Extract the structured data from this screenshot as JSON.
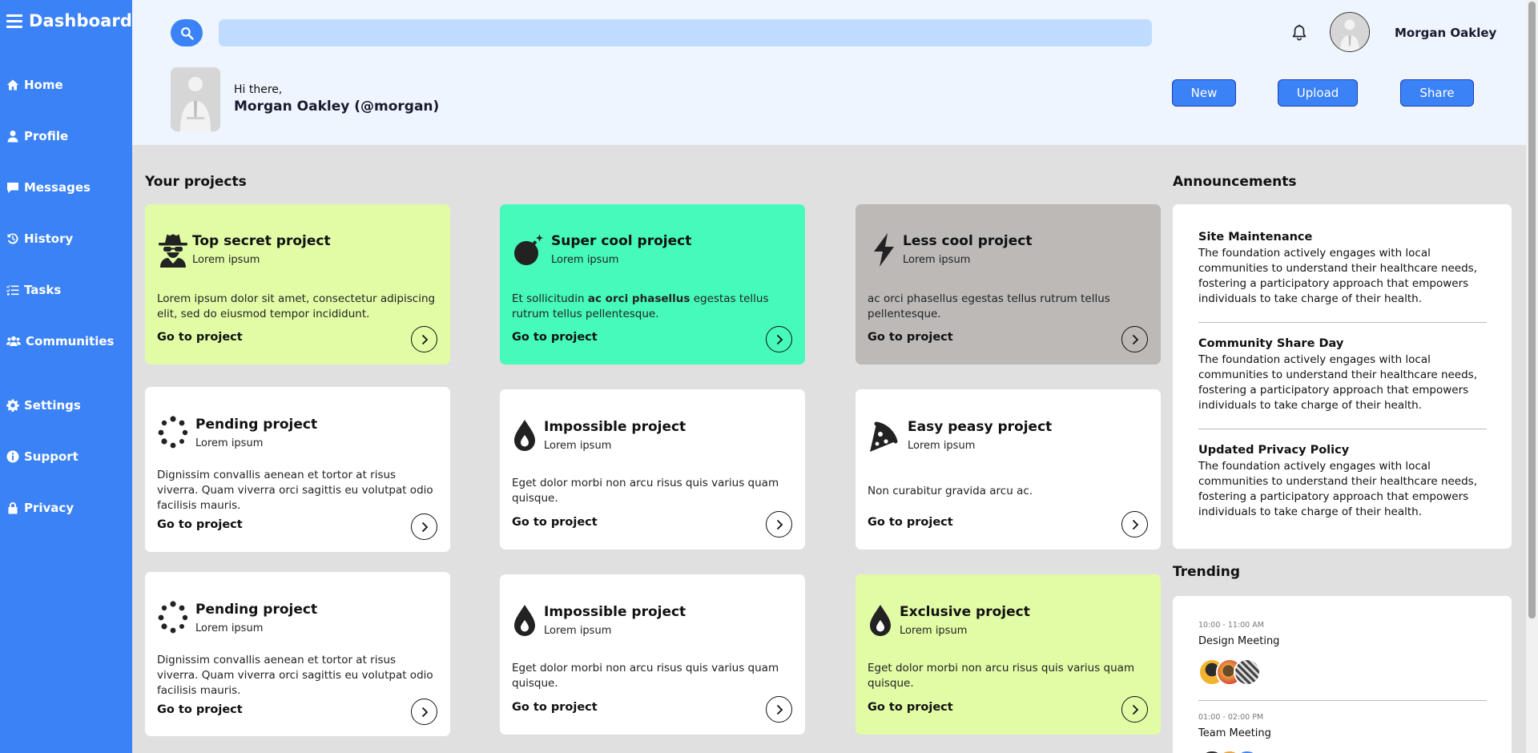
{
  "sidebar": {
    "title": "Dashboard",
    "items": [
      {
        "label": "Home",
        "icon": "home-icon"
      },
      {
        "label": "Profile",
        "icon": "user-icon"
      },
      {
        "label": "Messages",
        "icon": "message-icon"
      },
      {
        "label": "History",
        "icon": "history-icon"
      },
      {
        "label": "Tasks",
        "icon": "tasks-icon"
      },
      {
        "label": "Communities",
        "icon": "users-icon"
      },
      {
        "label": "Settings",
        "icon": "gear-icon"
      },
      {
        "label": "Support",
        "icon": "info-icon"
      },
      {
        "label": "Privacy",
        "icon": "lock-icon"
      }
    ]
  },
  "header": {
    "search": {
      "value": "",
      "placeholder": ""
    },
    "user_name": "Morgan Oakley",
    "greeting": "Hi there,",
    "greeting_name": "Morgan Oakley (@morgan)",
    "buttons": {
      "new": "New",
      "upload": "Upload",
      "share": "Share"
    }
  },
  "projects": {
    "title": "Your projects",
    "cards": [
      {
        "name": "Top secret project",
        "sub": "Lorem ipsum",
        "desc": "Lorem ipsum dolor sit amet, consectetur adipiscing elit, sed do eiusmod tempor incididunt.",
        "link": "Go to project",
        "icon": "spy-icon",
        "bg": "#e2fca6"
      },
      {
        "name": "Super cool project",
        "sub": "Lorem ipsum",
        "desc_pre": "Et sollicitudin ",
        "desc_bold": "ac orci phasellus",
        "desc_post": " egestas tellus rutrum tellus pellentesque.",
        "link": "Go to project",
        "icon": "bomb-icon",
        "bg": "#46fabb"
      },
      {
        "name": "Less cool project",
        "sub": "Lorem ipsum",
        "desc": "ac orci phasellus egestas tellus rutrum tellus pellentesque.",
        "link": "Go to project",
        "icon": "bolt-icon",
        "bg": "#bcb9b6"
      },
      {
        "name": "Pending project",
        "sub": "Lorem ipsum",
        "desc": "Dignissim convallis aenean et tortor at risus viverra. Quam viverra orci sagittis eu volutpat odio facilisis mauris.",
        "link": "Go to project",
        "icon": "spinner-icon",
        "bg": "#ffffff"
      },
      {
        "name": "Impossible project",
        "sub": "Lorem ipsum",
        "desc": "Eget dolor morbi non arcu risus quis varius quam quisque.",
        "link": "Go to project",
        "icon": "drop-icon",
        "bg": "#ffffff"
      },
      {
        "name": "Easy peasy project",
        "sub": "Lorem ipsum",
        "desc": "Non curabitur gravida arcu ac.",
        "link": "Go to project",
        "icon": "pizza-icon",
        "bg": "#ffffff"
      },
      {
        "name": "Pending project",
        "sub": "Lorem ipsum",
        "desc": "Dignissim convallis aenean et tortor at risus viverra. Quam viverra orci sagittis eu volutpat odio facilisis mauris.",
        "link": "Go to project",
        "icon": "spinner-icon",
        "bg": "#ffffff"
      },
      {
        "name": "Impossible project",
        "sub": "Lorem ipsum",
        "desc": "Eget dolor morbi non arcu risus quis varius quam quisque.",
        "link": "Go to project",
        "icon": "drop-icon",
        "bg": "#ffffff"
      },
      {
        "name": "Exclusive project",
        "sub": "Lorem ipsum",
        "desc": "Eget dolor morbi non arcu risus quis varius quam quisque.",
        "link": "Go to project",
        "icon": "drop-icon",
        "bg": "#e2fca6"
      }
    ]
  },
  "announcements": {
    "title": "Announcements",
    "items": [
      {
        "title": "Site Maintenance",
        "desc": "The foundation actively engages with local communities to understand their healthcare needs, fostering a participatory approach that empowers individuals to take charge of their health."
      },
      {
        "title": "Community Share Day",
        "desc": "The foundation actively engages with local communities to understand their healthcare needs, fostering a participatory approach that empowers individuals to take charge of their health."
      },
      {
        "title": "Updated Privacy Policy",
        "desc": "The foundation actively engages with local communities to understand their healthcare needs, fostering a participatory approach that empowers individuals to take charge of their health."
      }
    ]
  },
  "trending": {
    "title": "Trending",
    "items": [
      {
        "time": "10:00 - 11:00 AM",
        "name": "Design Meeting"
      },
      {
        "time": "01:00 - 02:00 PM",
        "name": "Team Meeting"
      }
    ]
  },
  "colors": {
    "accent": "#3b82f6",
    "header_bg": "#eef5ff",
    "search_bg": "#bfdbfe",
    "page_bg": "#e0e0e0"
  }
}
